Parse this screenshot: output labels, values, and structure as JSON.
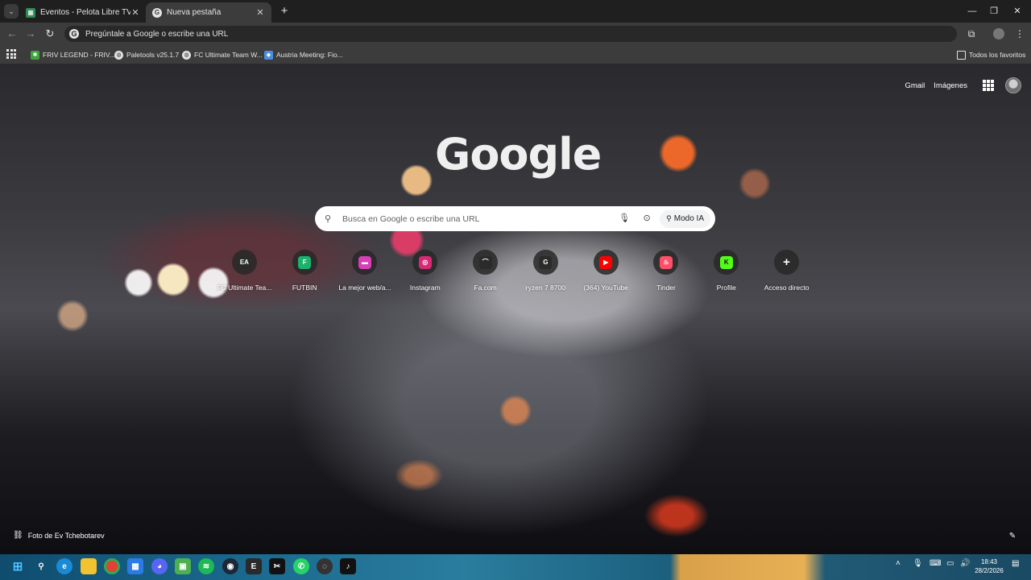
{
  "browser": {
    "tabs": [
      {
        "title": "Eventos - Pelota Libre TV",
        "active": false
      },
      {
        "title": "Nueva pestaña",
        "active": true
      }
    ],
    "omnibox_text": "Pregúntale a Google o escribe una URL",
    "bookmarks": [
      "FRIV LEGEND - FRIV...",
      "Paletools v25.1.7",
      "FC Ultimate Team W...",
      "Austria Meeting: Fio..."
    ],
    "all_bookmarks_label": "Todos los favoritos"
  },
  "header": {
    "gmail": "Gmail",
    "images": "Imágenes"
  },
  "logo_text": "Google",
  "search": {
    "placeholder": "Busca en Google o escribe una URL",
    "ai_mode": "Modo IA"
  },
  "shortcuts": [
    {
      "label": "FC Ultimate Tea...",
      "icon": "ea-icon",
      "color": "#2b2b2b",
      "glyph": "EA"
    },
    {
      "label": "FUTBIN",
      "icon": "futbin-icon",
      "color": "#19b36b",
      "glyph": "F"
    },
    {
      "label": "La mejor web/a...",
      "icon": "web-icon",
      "color": "#d63fb6",
      "glyph": "▬"
    },
    {
      "label": "Instagram",
      "icon": "instagram-icon",
      "color": "#d62976",
      "glyph": "◎"
    },
    {
      "label": "Fa.com",
      "icon": "fa-icon",
      "color": "#2b2b2b",
      "glyph": "⌒"
    },
    {
      "label": "ryzen 7 8700",
      "icon": "ryzen-icon",
      "color": "#2b2b2b",
      "glyph": "G"
    },
    {
      "label": "(364) YouTube",
      "icon": "youtube-icon",
      "color": "#ff0000",
      "glyph": "▶"
    },
    {
      "label": "Tinder",
      "icon": "tinder-icon",
      "color": "#fd5068",
      "glyph": "♨"
    },
    {
      "label": "Profile",
      "icon": "kick-icon",
      "color": "#53fc18",
      "glyph": "K"
    },
    {
      "label": "Acceso directo",
      "icon": "plus-icon",
      "color": "#3a3a3a",
      "glyph": "+"
    }
  ],
  "photo_credit": "Foto de Ev Tchebotarev",
  "taskbar": {
    "time": "18:43",
    "date": "28/2/2026"
  }
}
